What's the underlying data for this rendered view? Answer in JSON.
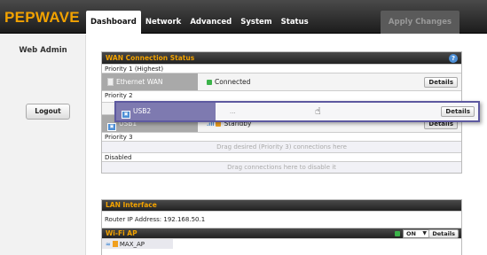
{
  "brand": {
    "logo": "PEPWAVE",
    "logo_color": "#f2a200"
  },
  "nav": {
    "tabs": [
      {
        "label": "Dashboard",
        "active": true
      },
      {
        "label": "Network"
      },
      {
        "label": "Advanced"
      },
      {
        "label": "System"
      },
      {
        "label": "Status"
      }
    ],
    "apply_label": "Apply Changes"
  },
  "sidebar": {
    "title": "Web Admin",
    "logout_label": "Logout"
  },
  "wan": {
    "title": "WAN Connection Status",
    "help_icon": "?",
    "priority1_label": "Priority 1 (Highest)",
    "priority2_label": "Priority 2",
    "priority3_label": "Priority 3",
    "disabled_label": "Disabled",
    "priority3_hint": "Drag desired (Priority 3) connections here",
    "disabled_hint": "Drag connections here to disable it",
    "connections": {
      "ethernet": {
        "name": "Ethernet WAN",
        "status": "Connected",
        "details": "Details",
        "icon": "ethernet-port-icon"
      },
      "usb2": {
        "name": "USB2",
        "status": "...",
        "details": "Details",
        "icon": "usb-modem-icon"
      },
      "usb1": {
        "name": "USB1",
        "status": "Standby",
        "details": "Details",
        "icon": "usb-modem-icon",
        "signal": ".ıll"
      }
    },
    "colors": {
      "connected": "#3bb34a",
      "standby": "#f0a020"
    }
  },
  "lan": {
    "title": "LAN Interface",
    "router_ip": "Router IP Address: 192.168.50.1"
  },
  "wifi": {
    "title": "Wi-Fi AP",
    "state": "ON",
    "details": "Details",
    "ssid": "MAX_AP"
  }
}
